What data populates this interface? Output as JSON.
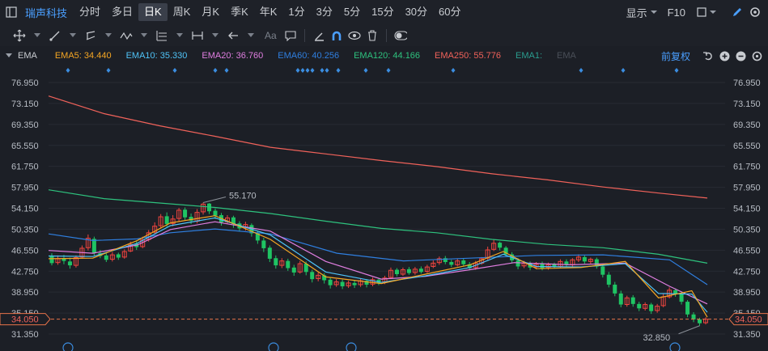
{
  "stock_name": "瑞声科技",
  "periods": [
    "分时",
    "多日",
    "日K",
    "周K",
    "月K",
    "季K",
    "年K",
    "1分",
    "3分",
    "5分",
    "15分",
    "30分",
    "60分"
  ],
  "active_period": "日K",
  "right_controls": {
    "display_label": "显示",
    "f10_label": "F10"
  },
  "tool_text": {
    "text_tool": "Aa"
  },
  "indicator": {
    "name": "EMA",
    "items": [
      {
        "label": "EMA5: 34.440",
        "color": "#f5a623"
      },
      {
        "label": "EMA10: 35.330",
        "color": "#4fc3f7"
      },
      {
        "label": "EMA20: 36.760",
        "color": "#e07ee0"
      },
      {
        "label": "EMA60: 40.256",
        "color": "#2f7fe0"
      },
      {
        "label": "EMA120: 44.166",
        "color": "#2ec27e"
      },
      {
        "label": "EMA250: 55.776",
        "color": "#f0625a"
      },
      {
        "label": "EMA1:",
        "color": "#2a9d8f"
      },
      {
        "label": "EMA",
        "color": "#4a4f58"
      }
    ],
    "adjust_label": "前复权"
  },
  "chart_data": {
    "type": "line",
    "y_ticks": [
      "76.950",
      "73.150",
      "69.350",
      "65.550",
      "61.750",
      "57.950",
      "54.150",
      "50.350",
      "46.550",
      "42.750",
      "38.950",
      "35.150",
      "31.350"
    ],
    "y_range": [
      31.35,
      76.95
    ],
    "current_price": "34.050",
    "annotations": {
      "high": "55.170",
      "low": "32.850"
    },
    "ema_series": [
      {
        "name": "EMA250",
        "color": "#f0625a",
        "points": [
          [
            0,
            74.5
          ],
          [
            50,
            71.3
          ],
          [
            100,
            69.1
          ],
          [
            150,
            67.2
          ],
          [
            200,
            65.2
          ],
          [
            250,
            64.0
          ],
          [
            300,
            62.8
          ],
          [
            350,
            61.7
          ],
          [
            400,
            60.4
          ],
          [
            450,
            59.3
          ],
          [
            500,
            58.0
          ],
          [
            550,
            56.9
          ],
          [
            594,
            56.0
          ]
        ]
      },
      {
        "name": "EMA120",
        "color": "#2ec27e",
        "points": [
          [
            0,
            57.5
          ],
          [
            50,
            55.9
          ],
          [
            100,
            55.1
          ],
          [
            150,
            54.3
          ],
          [
            200,
            53.2
          ],
          [
            250,
            51.8
          ],
          [
            300,
            50.5
          ],
          [
            350,
            49.7
          ],
          [
            400,
            48.5
          ],
          [
            450,
            47.6
          ],
          [
            500,
            47.0
          ],
          [
            550,
            45.8
          ],
          [
            594,
            44.2
          ]
        ]
      },
      {
        "name": "EMA60",
        "color": "#2f7fe0",
        "points": [
          [
            0,
            49.5
          ],
          [
            40,
            48.3
          ],
          [
            80,
            48.6
          ],
          [
            110,
            49.7
          ],
          [
            150,
            50.4
          ],
          [
            200,
            49.5
          ],
          [
            260,
            46.0
          ],
          [
            320,
            44.6
          ],
          [
            380,
            45.1
          ],
          [
            440,
            45.6
          ],
          [
            500,
            45.7
          ],
          [
            560,
            44.8
          ],
          [
            594,
            40.3
          ]
        ]
      },
      {
        "name": "EMA20",
        "color": "#e07ee0",
        "points": [
          [
            0,
            46.5
          ],
          [
            40,
            46.0
          ],
          [
            80,
            47.5
          ],
          [
            110,
            50.3
          ],
          [
            150,
            51.7
          ],
          [
            200,
            50.0
          ],
          [
            250,
            44.5
          ],
          [
            300,
            41.3
          ],
          [
            340,
            41.8
          ],
          [
            380,
            43.0
          ],
          [
            420,
            44.3
          ],
          [
            470,
            43.9
          ],
          [
            520,
            44.2
          ],
          [
            560,
            40.0
          ],
          [
            594,
            36.8
          ]
        ]
      },
      {
        "name": "EMA10",
        "color": "#4fc3f7",
        "points": [
          [
            0,
            45.5
          ],
          [
            40,
            45.4
          ],
          [
            80,
            47.8
          ],
          [
            110,
            51.0
          ],
          [
            150,
            52.4
          ],
          [
            200,
            49.3
          ],
          [
            250,
            42.6
          ],
          [
            300,
            40.7
          ],
          [
            340,
            41.9
          ],
          [
            380,
            43.4
          ],
          [
            410,
            45.8
          ],
          [
            440,
            43.6
          ],
          [
            480,
            43.5
          ],
          [
            520,
            44.1
          ],
          [
            550,
            38.7
          ],
          [
            580,
            38.6
          ],
          [
            594,
            35.3
          ]
        ]
      },
      {
        "name": "EMA5",
        "color": "#f5a623",
        "points": [
          [
            0,
            45.0
          ],
          [
            40,
            45.1
          ],
          [
            80,
            48.3
          ],
          [
            110,
            51.5
          ],
          [
            150,
            52.8
          ],
          [
            200,
            48.5
          ],
          [
            250,
            41.7
          ],
          [
            300,
            40.5
          ],
          [
            340,
            42.2
          ],
          [
            380,
            43.9
          ],
          [
            410,
            46.3
          ],
          [
            440,
            43.2
          ],
          [
            480,
            43.4
          ],
          [
            520,
            44.5
          ],
          [
            550,
            37.9
          ],
          [
            580,
            39.2
          ],
          [
            594,
            34.4
          ]
        ]
      }
    ],
    "candles": [
      [
        45.5,
        44.2,
        46.0,
        43.8
      ],
      [
        44.3,
        45.0,
        45.6,
        43.9
      ],
      [
        45.1,
        44.6,
        45.7,
        44.0
      ],
      [
        44.5,
        43.8,
        45.2,
        43.2
      ],
      [
        43.8,
        45.2,
        45.6,
        43.4
      ],
      [
        45.3,
        46.9,
        47.4,
        45.0
      ],
      [
        47.0,
        48.7,
        49.4,
        46.5
      ],
      [
        48.6,
        46.0,
        49.0,
        45.6
      ],
      [
        46.0,
        45.5,
        46.6,
        45.1
      ],
      [
        45.6,
        44.8,
        46.2,
        44.4
      ],
      [
        44.9,
        45.7,
        46.2,
        44.5
      ],
      [
        45.8,
        45.2,
        46.1,
        44.8
      ],
      [
        45.3,
        46.3,
        46.7,
        45.0
      ],
      [
        46.4,
        47.6,
        48.1,
        46.2
      ],
      [
        47.7,
        47.1,
        48.3,
        46.6
      ],
      [
        47.2,
        48.4,
        49.0,
        46.9
      ],
      [
        48.5,
        49.7,
        50.2,
        48.1
      ],
      [
        49.8,
        50.9,
        51.6,
        49.4
      ],
      [
        51.0,
        52.6,
        53.1,
        50.5
      ],
      [
        52.7,
        51.3,
        53.4,
        50.8
      ],
      [
        51.4,
        52.2,
        52.9,
        50.9
      ],
      [
        52.3,
        53.8,
        54.2,
        51.8
      ],
      [
        53.9,
        52.5,
        54.3,
        51.9
      ],
      [
        52.6,
        51.9,
        53.2,
        51.3
      ],
      [
        51.8,
        53.4,
        54.0,
        51.4
      ],
      [
        53.5,
        54.9,
        55.17,
        53.0
      ],
      [
        55.0,
        53.6,
        55.1,
        53.1
      ],
      [
        53.7,
        52.8,
        54.1,
        52.2
      ],
      [
        52.9,
        51.6,
        53.3,
        51.0
      ],
      [
        51.7,
        52.4,
        52.9,
        51.3
      ],
      [
        52.5,
        51.3,
        52.8,
        50.6
      ],
      [
        51.4,
        50.5,
        51.8,
        49.9
      ],
      [
        50.6,
        51.2,
        51.7,
        50.1
      ],
      [
        51.1,
        49.6,
        51.4,
        49.0
      ],
      [
        49.6,
        48.3,
        50.0,
        47.7
      ],
      [
        48.3,
        46.9,
        48.8,
        46.2
      ],
      [
        47.0,
        45.0,
        47.4,
        44.4
      ],
      [
        45.1,
        43.8,
        45.6,
        43.2
      ],
      [
        43.8,
        44.6,
        45.1,
        43.3
      ],
      [
        44.6,
        43.3,
        45.0,
        42.8
      ],
      [
        43.4,
        42.5,
        43.9,
        41.9
      ],
      [
        42.6,
        44.1,
        44.6,
        42.3
      ],
      [
        44.1,
        42.6,
        44.5,
        42.0
      ],
      [
        42.6,
        41.3,
        43.0,
        40.7
      ],
      [
        41.4,
        42.0,
        42.5,
        40.9
      ],
      [
        42.0,
        41.1,
        42.4,
        40.5
      ],
      [
        41.2,
        40.2,
        41.6,
        39.6
      ],
      [
        40.3,
        40.8,
        41.3,
        39.9
      ],
      [
        40.8,
        40.0,
        41.2,
        39.5
      ],
      [
        40.1,
        40.6,
        41.0,
        39.7
      ],
      [
        40.6,
        40.2,
        41.1,
        39.7
      ],
      [
        40.3,
        41.0,
        41.4,
        39.9
      ],
      [
        41.0,
        40.3,
        41.3,
        39.8
      ],
      [
        40.4,
        41.2,
        41.6,
        40.0
      ],
      [
        41.2,
        40.6,
        41.5,
        40.2
      ],
      [
        40.7,
        41.5,
        41.9,
        40.4
      ],
      [
        41.6,
        42.9,
        43.4,
        41.3
      ],
      [
        43.0,
        42.2,
        43.3,
        41.8
      ],
      [
        42.2,
        43.0,
        43.4,
        41.9
      ],
      [
        43.1,
        42.4,
        43.5,
        42.1
      ],
      [
        42.5,
        43.1,
        43.5,
        42.1
      ],
      [
        43.2,
        42.6,
        43.6,
        42.3
      ],
      [
        42.7,
        43.5,
        43.9,
        42.4
      ],
      [
        43.6,
        44.2,
        44.7,
        43.3
      ],
      [
        44.3,
        45.0,
        45.4,
        43.9
      ],
      [
        45.1,
        44.4,
        45.5,
        44.0
      ],
      [
        44.4,
        43.9,
        44.8,
        43.5
      ],
      [
        43.9,
        44.6,
        45.0,
        43.6
      ],
      [
        44.7,
        44.0,
        45.1,
        43.6
      ],
      [
        44.0,
        43.3,
        44.4,
        42.9
      ],
      [
        43.4,
        44.2,
        44.6,
        43.0
      ],
      [
        44.2,
        45.0,
        45.3,
        43.9
      ],
      [
        45.1,
        46.6,
        47.2,
        44.8
      ],
      [
        46.7,
        47.8,
        48.5,
        46.4
      ],
      [
        47.9,
        47.0,
        48.1,
        46.5
      ],
      [
        47.0,
        45.8,
        47.3,
        45.3
      ],
      [
        45.8,
        44.7,
        46.2,
        44.2
      ],
      [
        44.7,
        43.6,
        45.1,
        43.1
      ],
      [
        43.7,
        44.2,
        44.6,
        43.3
      ],
      [
        44.2,
        43.4,
        44.5,
        42.9
      ],
      [
        43.5,
        44.0,
        44.4,
        43.1
      ],
      [
        44.1,
        43.3,
        44.5,
        42.9
      ],
      [
        43.4,
        43.9,
        44.3,
        43.0
      ],
      [
        44.0,
        43.6,
        44.3,
        43.2
      ],
      [
        43.6,
        44.5,
        44.9,
        43.3
      ],
      [
        44.5,
        43.9,
        44.9,
        43.5
      ],
      [
        43.9,
        44.8,
        45.1,
        43.6
      ],
      [
        44.8,
        45.3,
        45.8,
        44.4
      ],
      [
        45.3,
        44.5,
        45.6,
        44.1
      ],
      [
        44.5,
        44.9,
        45.2,
        44.1
      ],
      [
        44.9,
        43.6,
        45.2,
        43.2
      ],
      [
        43.6,
        42.1,
        44.0,
        41.6
      ],
      [
        42.1,
        40.3,
        42.6,
        39.8
      ],
      [
        40.3,
        38.7,
        40.8,
        38.2
      ],
      [
        38.7,
        36.7,
        39.2,
        36.2
      ],
      [
        36.7,
        37.9,
        38.3,
        36.3
      ],
      [
        38.0,
        36.8,
        38.4,
        36.3
      ],
      [
        36.8,
        36.0,
        37.2,
        35.5
      ],
      [
        36.0,
        36.7,
        37.1,
        35.6
      ],
      [
        36.7,
        35.5,
        37.0,
        35.0
      ],
      [
        35.6,
        36.4,
        36.8,
        35.2
      ],
      [
        36.5,
        38.1,
        38.6,
        36.2
      ],
      [
        38.1,
        39.3,
        39.8,
        37.8
      ],
      [
        39.3,
        38.6,
        39.6,
        38.1
      ],
      [
        38.6,
        37.2,
        38.9,
        36.7
      ],
      [
        37.2,
        34.9,
        37.5,
        34.4
      ],
      [
        34.9,
        34.0,
        35.3,
        33.5
      ],
      [
        34.0,
        33.3,
        34.3,
        32.85
      ],
      [
        33.4,
        34.05,
        34.4,
        33.1
      ]
    ]
  }
}
